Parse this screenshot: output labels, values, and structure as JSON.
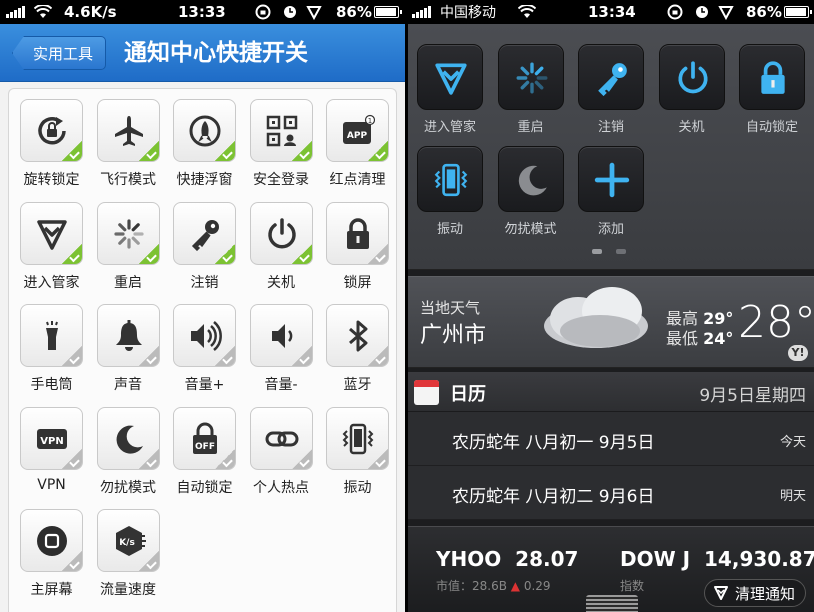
{
  "left_status": {
    "network_speed": "4.6K/s",
    "time": "13:33",
    "battery": "86%"
  },
  "left_header": {
    "back_label": "实用工具",
    "title": "通知中心快捷开关"
  },
  "tools": [
    {
      "label": "旋转锁定",
      "icon": "rotation-lock-icon",
      "checked": true
    },
    {
      "label": "飞行模式",
      "icon": "airplane-icon",
      "checked": true
    },
    {
      "label": "快捷浮窗",
      "icon": "rocket-icon",
      "checked": true
    },
    {
      "label": "安全登录",
      "icon": "qr-code-icon",
      "checked": true
    },
    {
      "label": "红点清理",
      "icon": "app-badge-icon",
      "checked": true
    },
    {
      "label": "进入管家",
      "icon": "shield-icon",
      "checked": true
    },
    {
      "label": "重启",
      "icon": "spinner-icon",
      "checked": true
    },
    {
      "label": "注销",
      "icon": "key-icon",
      "checked": true
    },
    {
      "label": "关机",
      "icon": "power-icon",
      "checked": true
    },
    {
      "label": "锁屏",
      "icon": "lock-icon",
      "checked": false
    },
    {
      "label": "手电筒",
      "icon": "flashlight-icon",
      "checked": false
    },
    {
      "label": "声音",
      "icon": "bell-icon",
      "checked": false
    },
    {
      "label": "音量+",
      "icon": "volume-up-icon",
      "checked": false
    },
    {
      "label": "音量-",
      "icon": "volume-down-icon",
      "checked": false
    },
    {
      "label": "蓝牙",
      "icon": "bluetooth-icon",
      "checked": false
    },
    {
      "label": "VPN",
      "icon": "vpn-icon",
      "checked": false
    },
    {
      "label": "勿扰模式",
      "icon": "moon-icon",
      "checked": false
    },
    {
      "label": "自动锁定",
      "icon": "lock-off-icon",
      "checked": false
    },
    {
      "label": "个人热点",
      "icon": "link-icon",
      "checked": false
    },
    {
      "label": "振动",
      "icon": "vibrate-icon",
      "checked": false
    },
    {
      "label": "主屏幕",
      "icon": "home-button-icon",
      "checked": false
    },
    {
      "label": "流量速度",
      "icon": "speed-icon",
      "checked": false
    }
  ],
  "right_status": {
    "carrier": "中国移动",
    "time": "13:34",
    "battery": "86%"
  },
  "nc_toggles": [
    {
      "label": "进入管家",
      "icon": "shield-icon"
    },
    {
      "label": "重启",
      "icon": "spinner-icon"
    },
    {
      "label": "注销",
      "icon": "key-icon"
    },
    {
      "label": "关机",
      "icon": "power-icon"
    },
    {
      "label": "自动锁定",
      "icon": "lock-icon"
    },
    {
      "label": "振动",
      "icon": "vibrate-icon"
    },
    {
      "label": "勿扰模式",
      "icon": "moon-icon"
    },
    {
      "label": "添加",
      "icon": "plus-icon"
    }
  ],
  "weather": {
    "label": "当地天气",
    "city": "广州市",
    "high_label": "最高",
    "high": "29°",
    "low_label": "最低",
    "low": "24°",
    "temp": "28°",
    "provider_mark": "Y!"
  },
  "calendar": {
    "title": "日历",
    "date": "9月5日星期四",
    "events": [
      {
        "text": "农历蛇年 八月初一 9月5日",
        "when": "今天"
      },
      {
        "text": "农历蛇年 八月初二 9月6日",
        "when": "明天"
      }
    ]
  },
  "stocks": {
    "items": [
      {
        "symbol": "YHOO",
        "price": "28.07",
        "sub": "市值：28.6B",
        "change": "0.29"
      },
      {
        "symbol": "DOW J",
        "price": "14,930.87",
        "sub": "指数",
        "change": ""
      }
    ],
    "clear_label": "清理通知"
  },
  "colors": {
    "accent_blue": "#2a7ed6",
    "check_green": "#7cc233",
    "nc_icon_blue": "#3fb3f0"
  }
}
